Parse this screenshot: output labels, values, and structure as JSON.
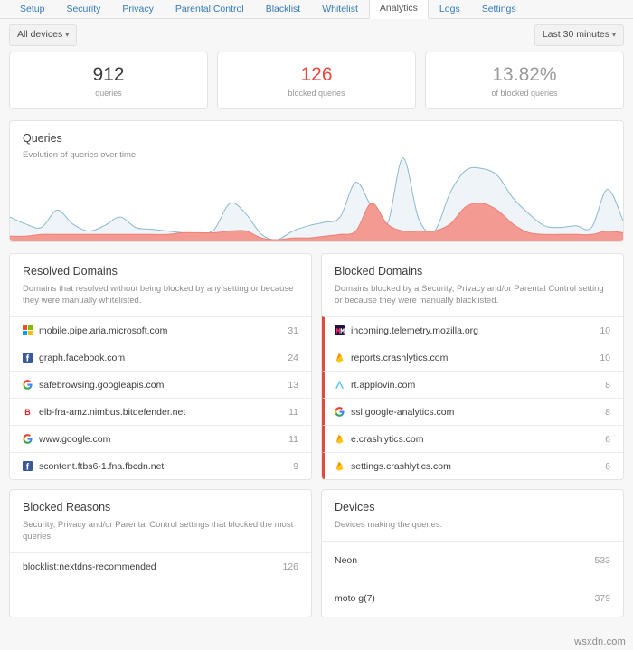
{
  "nav": {
    "tabs": [
      {
        "label": "Setup",
        "active": false
      },
      {
        "label": "Security",
        "active": false
      },
      {
        "label": "Privacy",
        "active": false
      },
      {
        "label": "Parental Control",
        "active": false
      },
      {
        "label": "Blacklist",
        "active": false
      },
      {
        "label": "Whitelist",
        "active": false
      },
      {
        "label": "Analytics",
        "active": true
      },
      {
        "label": "Logs",
        "active": false
      },
      {
        "label": "Settings",
        "active": false
      }
    ]
  },
  "filters": {
    "device_selector": "All devices",
    "time_selector": "Last 30 minutes",
    "caret": "▾"
  },
  "stats": [
    {
      "value": "912",
      "label": "queries",
      "color": "#3c3c3c",
      "style": ""
    },
    {
      "value": "126",
      "label": "blocked queries",
      "color": "#e8493f",
      "style": "red"
    },
    {
      "value": "13.82%",
      "label": "of blocked queries",
      "color": "#9b9b9b",
      "style": "grey"
    }
  ],
  "queries_chart": {
    "title": "Queries",
    "subtitle": "Evolution of queries over time."
  },
  "chart_data": {
    "type": "area",
    "title": "Queries",
    "subtitle": "Evolution of queries over time.",
    "xlabel": "",
    "ylabel": "",
    "grid": false,
    "legend": "none",
    "x": [
      0,
      1,
      2,
      3,
      4,
      5,
      6,
      7,
      8,
      9,
      10,
      11,
      12,
      13,
      14,
      15,
      16,
      17,
      18,
      19,
      20,
      21,
      22,
      23,
      24,
      25,
      26,
      27,
      28,
      29,
      30,
      31,
      32,
      33,
      34,
      35,
      36,
      37,
      38,
      39
    ],
    "series": [
      {
        "name": "queries",
        "color": "#8cb9d0",
        "fill": "#eef4f8",
        "values": [
          14,
          10,
          8,
          18,
          10,
          6,
          9,
          14,
          8,
          7,
          6,
          5,
          4,
          7,
          22,
          16,
          4,
          1,
          6,
          9,
          11,
          14,
          34,
          20,
          10,
          48,
          13,
          6,
          28,
          41,
          42,
          38,
          25,
          16,
          9,
          8,
          9,
          8,
          30,
          12
        ]
      },
      {
        "name": "blocked queries",
        "color": "#ef8077",
        "fill": "#f39a93",
        "values": [
          3,
          3,
          4,
          4,
          4,
          4,
          4,
          4,
          4,
          4,
          4,
          5,
          5,
          5,
          6,
          6,
          2,
          1,
          2,
          2,
          3,
          4,
          6,
          22,
          10,
          6,
          6,
          6,
          10,
          20,
          22,
          18,
          10,
          5,
          4,
          4,
          4,
          4,
          6,
          5
        ]
      }
    ],
    "ylim": [
      0,
      50
    ]
  },
  "resolved_domains": {
    "title": "Resolved Domains",
    "subtitle": "Domains that resolved without being blocked by any setting or because they were manually whitelisted.",
    "rows": [
      {
        "name": "mobile.pipe.aria.microsoft.com",
        "count": "31",
        "icon": "microsoft-icon"
      },
      {
        "name": "graph.facebook.com",
        "count": "24",
        "icon": "facebook-icon"
      },
      {
        "name": "safebrowsing.googleapis.com",
        "count": "13",
        "icon": "google-icon"
      },
      {
        "name": "elb-fra-amz.nimbus.bitdefender.net",
        "count": "11",
        "icon": "bitdefender-icon"
      },
      {
        "name": "www.google.com",
        "count": "11",
        "icon": "google-icon"
      },
      {
        "name": "scontent.ftbs6-1.fna.fbcdn.net",
        "count": "9",
        "icon": "facebook-icon"
      }
    ]
  },
  "blocked_domains": {
    "title": "Blocked Domains",
    "subtitle": "Domains blocked by a Security, Privacy and/or Parental Control setting or because they were manually blacklisted.",
    "accent": "#e04b3f",
    "rows": [
      {
        "name": "incoming.telemetry.mozilla.org",
        "count": "10",
        "icon": "mozilla-icon"
      },
      {
        "name": "reports.crashlytics.com",
        "count": "10",
        "icon": "crashlytics-icon"
      },
      {
        "name": "rt.applovin.com",
        "count": "8",
        "icon": "applovin-icon"
      },
      {
        "name": "ssl.google-analytics.com",
        "count": "8",
        "icon": "google-icon"
      },
      {
        "name": "e.crashlytics.com",
        "count": "6",
        "icon": "crashlytics-icon"
      },
      {
        "name": "settings.crashlytics.com",
        "count": "6",
        "icon": "crashlytics-icon"
      }
    ]
  },
  "blocked_reasons": {
    "title": "Blocked Reasons",
    "subtitle": "Security, Privacy and/or Parental Control settings that blocked the most queries.",
    "rows": [
      {
        "name": "blocklist:nextdns-recommended",
        "count": "126"
      }
    ]
  },
  "devices": {
    "title": "Devices",
    "subtitle": "Devices making the queries.",
    "rows": [
      {
        "name": "Neon",
        "count": "533"
      },
      {
        "name": "moto g(7)",
        "count": "379"
      }
    ]
  },
  "watermark": "wsxdn.com"
}
